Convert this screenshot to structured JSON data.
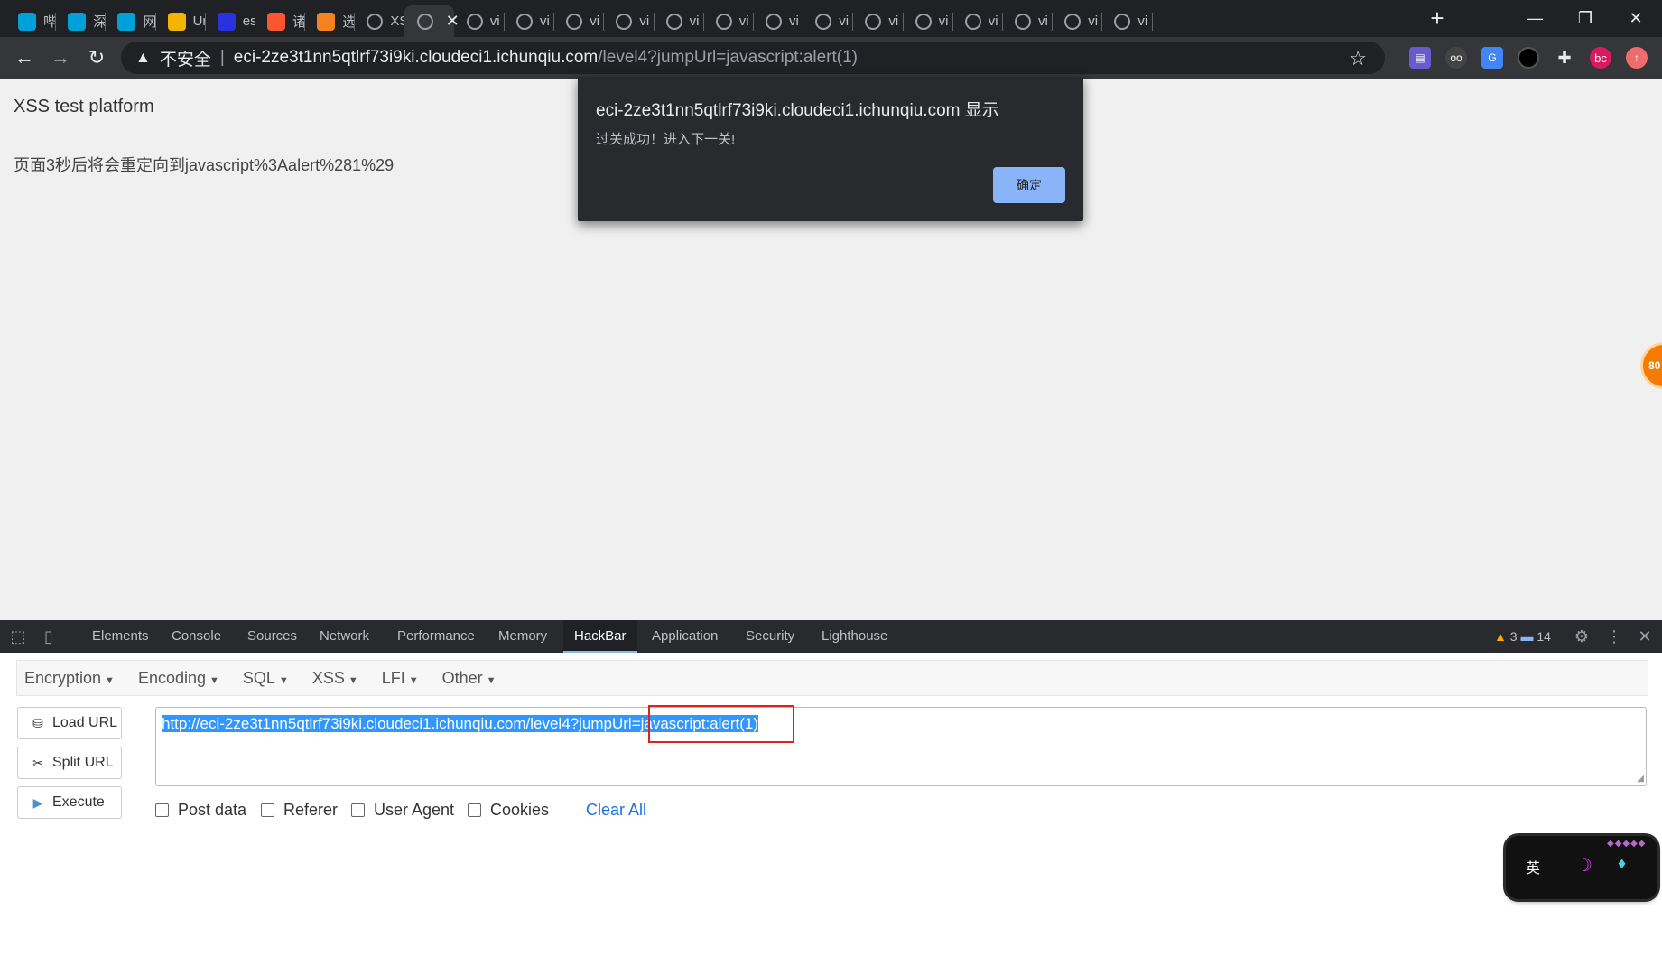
{
  "browser": {
    "tabs": [
      {
        "label": "哔",
        "icon": "bilibili-icon",
        "color": "#00a1d6"
      },
      {
        "label": "深",
        "icon": "bilibili-icon",
        "color": "#00a1d6"
      },
      {
        "label": "网",
        "icon": "bilibili-icon",
        "color": "#00a1d6"
      },
      {
        "label": "Ur",
        "icon": "colorful-square-icon",
        "color": "#f4b400"
      },
      {
        "label": "es",
        "icon": "baidu-paw-icon",
        "color": "#2932e1"
      },
      {
        "label": "诸",
        "icon": "csdn-icon",
        "color": "#fc5531"
      },
      {
        "label": "选",
        "icon": "hexagon-icon",
        "color": "#f58220"
      },
      {
        "label": "XS",
        "icon": "globe-icon",
        "color": "#9aa0a6"
      },
      {
        "label": "",
        "icon": "globe-icon",
        "color": "#9aa0a6",
        "active": true
      },
      {
        "label": "vi",
        "icon": "globe-icon",
        "color": "#9aa0a6"
      },
      {
        "label": "vi",
        "icon": "globe-icon",
        "color": "#9aa0a6"
      },
      {
        "label": "vi",
        "icon": "globe-icon",
        "color": "#9aa0a6"
      },
      {
        "label": "vi",
        "icon": "globe-icon",
        "color": "#9aa0a6"
      },
      {
        "label": "vi",
        "icon": "globe-icon",
        "color": "#9aa0a6"
      },
      {
        "label": "vi",
        "icon": "globe-icon",
        "color": "#9aa0a6"
      },
      {
        "label": "vi",
        "icon": "globe-icon",
        "color": "#9aa0a6"
      },
      {
        "label": "vi",
        "icon": "globe-icon",
        "color": "#9aa0a6"
      },
      {
        "label": "vi",
        "icon": "globe-icon",
        "color": "#9aa0a6"
      },
      {
        "label": "vi",
        "icon": "globe-icon",
        "color": "#9aa0a6"
      },
      {
        "label": "vi",
        "icon": "globe-icon",
        "color": "#9aa0a6"
      },
      {
        "label": "vi",
        "icon": "globe-icon",
        "color": "#9aa0a6"
      },
      {
        "label": "vi",
        "icon": "globe-icon",
        "color": "#9aa0a6"
      },
      {
        "label": "vi",
        "icon": "globe-icon",
        "color": "#9aa0a6"
      }
    ],
    "omnibox": {
      "security_label": "不安全",
      "host": "eci-2ze3t1nn5qtlrf73i9ki.cloudeci1.ichunqiu.com",
      "path": "/level4?jumpUrl=javascript:alert(1)"
    },
    "profile_initials": "bc"
  },
  "page": {
    "title": "XSS test platform",
    "redirect_message": "页面3秒后将会重定向到javascript%3Aalert%281%29",
    "float_badge": "80"
  },
  "alert": {
    "title": "eci-2ze3t1nn5qtlrf73i9ki.cloudeci1.ichunqiu.com 显示",
    "message": "过关成功！进入下一关!",
    "ok_label": "确定"
  },
  "devtools": {
    "tabs": [
      "Elements",
      "Console",
      "Sources",
      "Network",
      "Performance",
      "Memory",
      "HackBar",
      "Application",
      "Security",
      "Lighthouse"
    ],
    "active_tab": "HackBar",
    "warning_count": "3",
    "message_count": "14"
  },
  "hackbar": {
    "menus": [
      "Encoding",
      "SQL",
      "XSS",
      "LFI",
      "Other"
    ],
    "first_menu": "Encryption",
    "buttons": {
      "load": "Load URL",
      "split": "Split URL",
      "execute": "Execute"
    },
    "url_part1": "http://eci-2ze3t1nn5qtlrf73i9ki.cloudeci1.ichunqiu.com/level4?jumpUrl",
    "url_part2": "=javascript:alert(1)",
    "checkboxes": [
      "Post data",
      "Referer",
      "User Agent",
      "Cookies"
    ],
    "clear_all": "Clear All"
  },
  "ime": {
    "mode": "英"
  },
  "colors": {
    "accent": "#8ab4f8",
    "selection": "#3297fd",
    "highlight_box": "#e02020"
  }
}
